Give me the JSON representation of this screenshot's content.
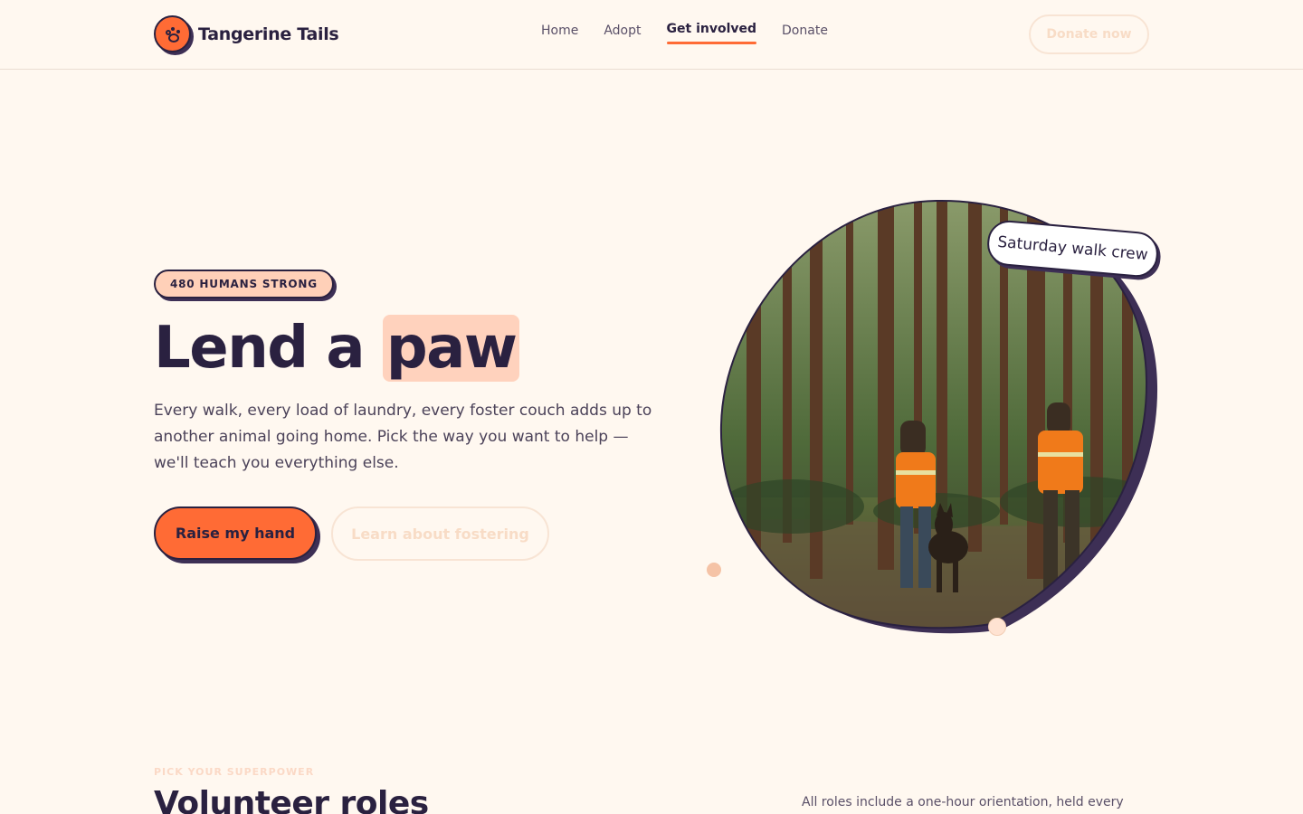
{
  "brand": {
    "name": "Tangerine Tails"
  },
  "nav": {
    "items": [
      {
        "label": "Home"
      },
      {
        "label": "Adopt"
      },
      {
        "label": "Get involved",
        "active": true
      },
      {
        "label": "Donate"
      }
    ],
    "cta": "Donate now"
  },
  "hero": {
    "tag": "480 HUMANS STRONG",
    "headline_pre": "Lend a",
    "headline_highlight": "paw",
    "lede": "Every walk, every load of laundry, every foster couch adds up to another animal going home. Pick the way you want to help — we'll teach you everything else.",
    "primary_cta": "Raise my hand",
    "secondary_cta": "Learn about fostering",
    "photo_caption": "Saturday walk crew"
  },
  "roles": {
    "eyebrow": "PICK YOUR SUPERPOWER",
    "title": "Volunteer roles",
    "note": "All roles include a one-hour orientation, held every"
  },
  "colors": {
    "accent": "#ff6b35",
    "ink": "#2a2140",
    "background": "#fff8f0",
    "highlight": "#ffd2bd"
  }
}
